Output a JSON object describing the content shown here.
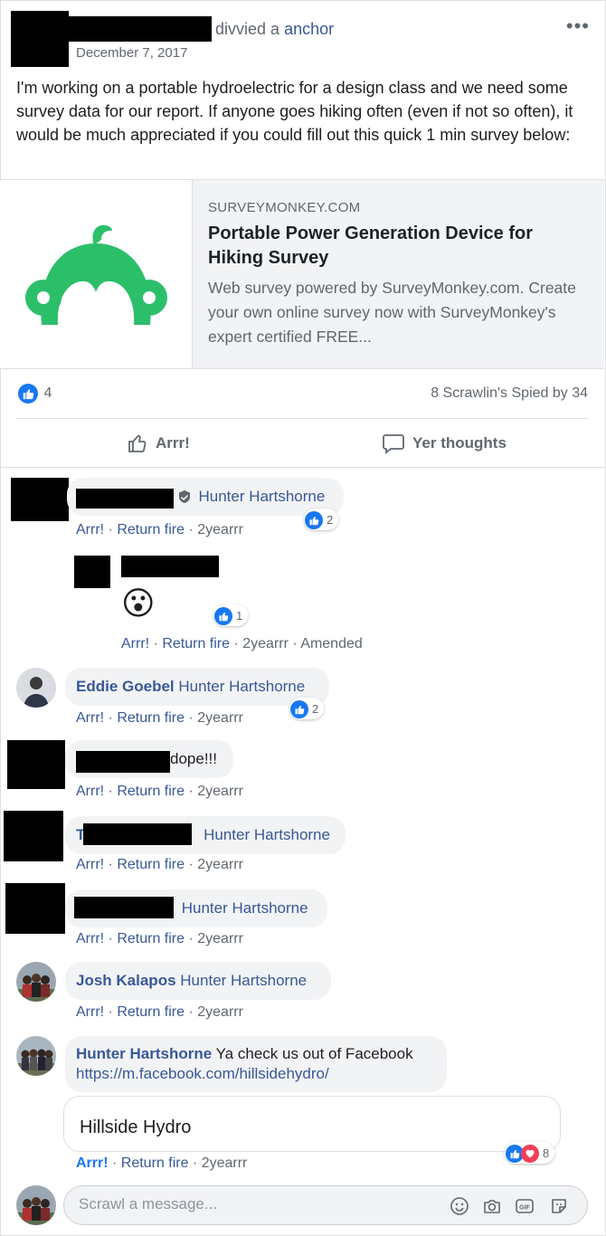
{
  "post": {
    "author_suffix": "divvied a",
    "author_link": "anchor",
    "date": "December 7, 2017",
    "more_label": "•••",
    "text": "I'm working on a portable hydroelectric for a design class and we need some survey data for our report. If anyone goes hiking often (even if not so often), it would be much appreciated if you could fill out this quick 1 min survey below:"
  },
  "link_card": {
    "domain": "SURVEYMONKEY.COM",
    "title": "Portable Power Generation Device for Hiking Survey",
    "description": "Web survey powered by SurveyMonkey.com. Create your own online survey now with SurveyMonkey's expert certified FREE...",
    "logo_color": "#2cbf6a"
  },
  "stats": {
    "like_count": "4",
    "shares_comments": "8 Scrawlin's  Spied by 34"
  },
  "actions": {
    "like_label": "Arrr!",
    "comment_label": "Yer thoughts"
  },
  "comments": [
    {
      "name": "",
      "text": "Hunter Hartshorne",
      "like": "Arrr!",
      "reply": "Return fire",
      "time": "2yearrr",
      "reactions": "2"
    },
    {
      "name": "",
      "text": "",
      "emoji": "😮",
      "like": "Arrr!",
      "reply": "Return fire",
      "time": "2yearrr",
      "edited": "Amended",
      "reactions": "1"
    },
    {
      "name": "Eddie Goebel",
      "text": "Hunter Hartshorne",
      "like": "Arrr!",
      "reply": "Return fire",
      "time": "2yearrr",
      "reactions": "2"
    },
    {
      "name": "",
      "text": "dope!!!",
      "like": "Arrr!",
      "reply": "Return fire",
      "time": "2yearrr"
    },
    {
      "name": "T",
      "text": "Hunter Hartshorne",
      "like": "Arrr!",
      "reply": "Return fire",
      "time": "2yearrr"
    },
    {
      "name": "",
      "text": "Hunter Hartshorne",
      "like": "Arrr!",
      "reply": "Return fire",
      "time": "2yearrr"
    },
    {
      "name": "Josh Kalapos",
      "text": "Hunter Hartshorne",
      "like": "Arrr!",
      "reply": "Return fire",
      "time": "2yearrr"
    },
    {
      "name": "Hunter Hartshorne",
      "text": "Ya check us out of Facebook",
      "url": "https://m.facebook.com/hillsidehydro/",
      "preview_title": "Hillside Hydro",
      "like": "Arrr!",
      "reply": "Return fire",
      "time": "2yearrr",
      "reactions": "8"
    }
  ],
  "composer": {
    "placeholder": "Scrawl a message..."
  },
  "colors": {
    "link": "#385898",
    "like_blue": "#1877f2",
    "love_red": "#f33e58",
    "bubble_bg": "#f2f3f5"
  }
}
